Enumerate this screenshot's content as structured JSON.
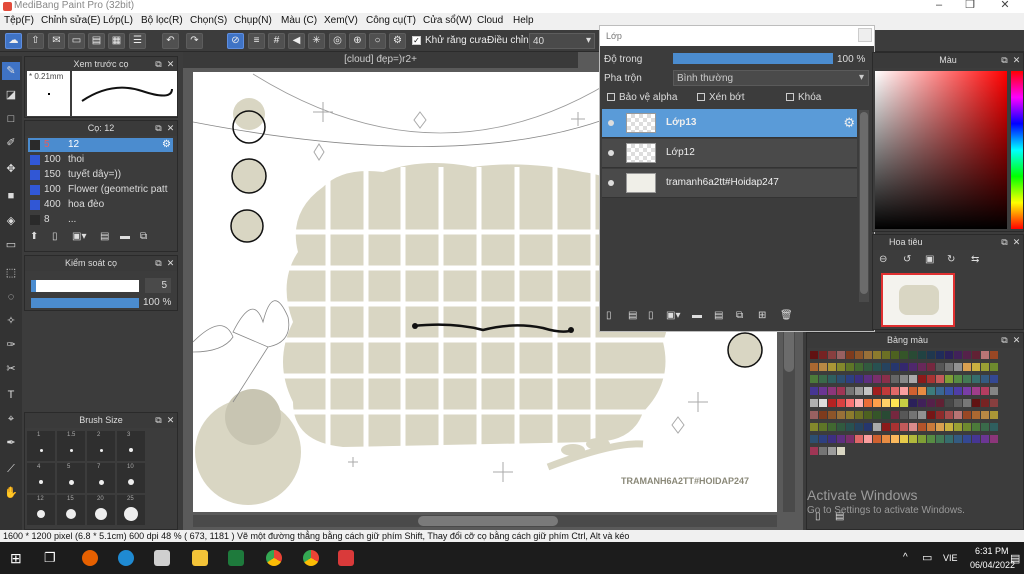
{
  "window": {
    "title": "MediBang Paint Pro (32bit)"
  },
  "menu": [
    "Tệp(F)",
    "Chỉnh sửa(E)",
    "Lớp(L)",
    "Bộ lọc(R)",
    "Chọn(S)",
    "Chụp(N)",
    "Màu (C)",
    "Xem(V)",
    "Công cụ(T)",
    "Cửa sổ(W)",
    "Cloud",
    "Help"
  ],
  "toolbar": {
    "antialias_label": "Khử răng cưa",
    "adjust_label": "Điều chỉnh",
    "adjust_value": "40"
  },
  "brush_preview": {
    "title": "Xem trước cọ",
    "size": "* 0.21mm"
  },
  "brush_list": {
    "title": "Cọ: 12",
    "items": [
      {
        "size": "5",
        "name": "12",
        "selected": true
      },
      {
        "size": "100",
        "name": "thoi"
      },
      {
        "size": "150",
        "name": "tuyết dây=))"
      },
      {
        "size": "100",
        "name": "Flower (geometric patt"
      },
      {
        "size": "400",
        "name": "hoa đèo"
      },
      {
        "size": "8",
        "name": "..."
      }
    ]
  },
  "brush_control": {
    "title": "Kiểm soát cọ",
    "size_value": "5",
    "opacity_value": "100 %",
    "opacity_fraction": 1.0,
    "size_fraction": 0.05
  },
  "brush_size": {
    "title": "Brush Size",
    "labels": [
      "1",
      "1.5",
      "2",
      "3",
      "4",
      "5",
      "7",
      "10",
      "12",
      "15",
      "20",
      "25"
    ]
  },
  "document": {
    "tab": "[cloud] đẹp=)r2+",
    "watermark": "TRAMANH6A2TT#HOIDAP247"
  },
  "layer_panel": {
    "title": "Lớp",
    "opacity_label": "Độ trong",
    "opacity_value": "100 %",
    "blend_label": "Pha trộn",
    "blend_value": "Bình thường",
    "protect_alpha": "Bảo vệ alpha",
    "clipping": "Xén bớt",
    "lock": "Khóa",
    "layers": [
      {
        "name": "Lớp13",
        "selected": true
      },
      {
        "name": "Lớp12"
      },
      {
        "name": "tramanh6a2tt#Hoidap247"
      }
    ]
  },
  "color_panel": {
    "title": "Màu"
  },
  "navigator": {
    "title": "Hoa tiêu"
  },
  "palette": {
    "title": "Bảng màu"
  },
  "status": {
    "text": "1600 * 1200 pixel   (6.8 * 5.1cm)  600 dpi  48 %   ( 673, 1181 )  Vẽ một đường thẳng bằng cách giữ phím Shift, Thay đổi cỡ cọ bằng cách giữ phím Ctrl, Alt và kéo"
  },
  "watermark_windows": {
    "line1": "Activate Windows",
    "line2": "Go to Settings to activate Windows."
  },
  "taskbar": {
    "time": "6:31 PM",
    "date": "06/04/2022",
    "lang": "VIE"
  },
  "colors": {
    "accent": "#4b8ccf",
    "beige": "#d9d6c3",
    "panel": "#3c3c3c"
  }
}
